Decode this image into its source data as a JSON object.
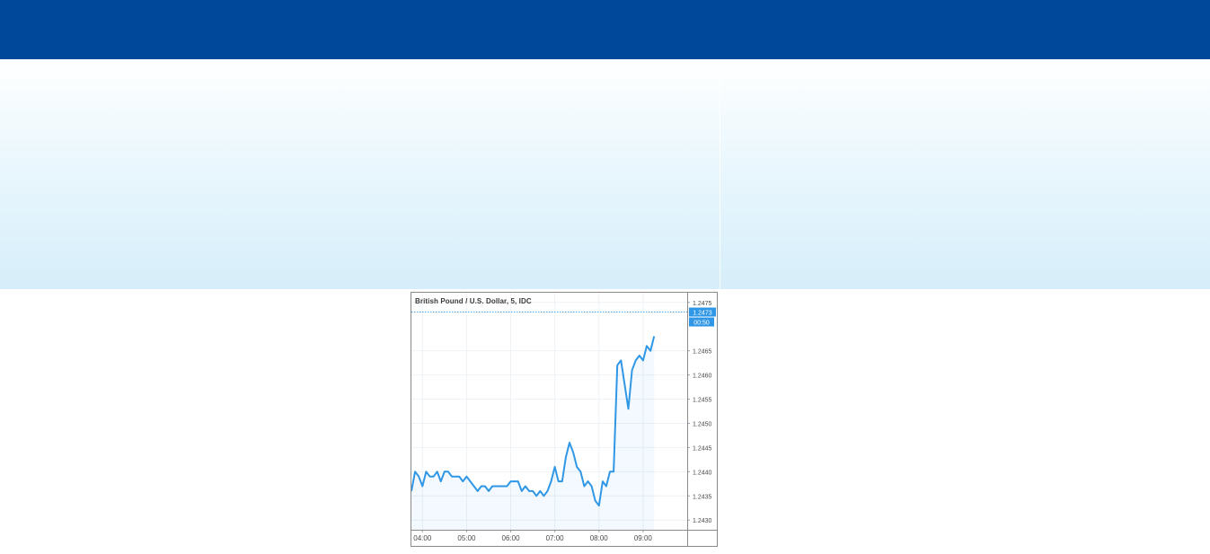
{
  "colors": {
    "top_bar": "#00489a",
    "line": "#2f97e6",
    "price_badge": "#2f97e6",
    "grid": "#eef2f6"
  },
  "chart_data": {
    "type": "line",
    "title": "British Pound / U.S. Dollar, 5, IDC",
    "x_ticks": [
      "04:00",
      "05:00",
      "06:00",
      "07:00",
      "08:00",
      "09:00"
    ],
    "y_ticks": [
      "1.2430",
      "1.2435",
      "1.2440",
      "1.2445",
      "1.2450",
      "1.2455",
      "1.2460",
      "1.2465",
      "1.2475"
    ],
    "ylim": [
      1.2428,
      1.2477
    ],
    "xlim": [
      "03:45",
      "10:00"
    ],
    "x": [
      "03:45",
      "03:50",
      "03:55",
      "04:00",
      "04:05",
      "04:10",
      "04:15",
      "04:20",
      "04:25",
      "04:30",
      "04:35",
      "04:40",
      "04:45",
      "04:50",
      "04:55",
      "05:00",
      "05:05",
      "05:10",
      "05:15",
      "05:20",
      "05:25",
      "05:30",
      "05:35",
      "05:40",
      "05:45",
      "05:50",
      "05:55",
      "06:00",
      "06:05",
      "06:10",
      "06:15",
      "06:20",
      "06:25",
      "06:30",
      "06:35",
      "06:40",
      "06:45",
      "06:50",
      "06:55",
      "07:00",
      "07:05",
      "07:10",
      "07:15",
      "07:20",
      "07:25",
      "07:30",
      "07:35",
      "07:40",
      "07:45",
      "07:50",
      "07:55",
      "08:00",
      "08:05",
      "08:10",
      "08:15",
      "08:20",
      "08:25",
      "08:30",
      "08:35",
      "08:40",
      "08:45",
      "08:50",
      "08:55",
      "09:00",
      "09:05",
      "09:10",
      "09:15"
    ],
    "values": [
      1.2436,
      1.244,
      1.2439,
      1.2437,
      1.244,
      1.2439,
      1.2439,
      1.244,
      1.2438,
      1.244,
      1.244,
      1.2439,
      1.2439,
      1.2439,
      1.2438,
      1.2439,
      1.2438,
      1.2437,
      1.2436,
      1.2437,
      1.2437,
      1.2436,
      1.2437,
      1.2437,
      1.2437,
      1.2437,
      1.2437,
      1.2438,
      1.2438,
      1.2438,
      1.2436,
      1.2437,
      1.2436,
      1.2436,
      1.2435,
      1.2436,
      1.2435,
      1.2436,
      1.2438,
      1.2441,
      1.2438,
      1.2438,
      1.2443,
      1.2446,
      1.2444,
      1.2441,
      1.244,
      1.2437,
      1.2438,
      1.2437,
      1.2434,
      1.2433,
      1.2438,
      1.2437,
      1.244,
      1.244,
      1.2462,
      1.2463,
      1.2458,
      1.2453,
      1.2461,
      1.2463,
      1.2464,
      1.2463,
      1.2466,
      1.2465,
      1.2468,
      1.247,
      1.2473
    ],
    "last_price": "1.2473",
    "countdown": "00:50",
    "grid": true,
    "price_line": true
  }
}
